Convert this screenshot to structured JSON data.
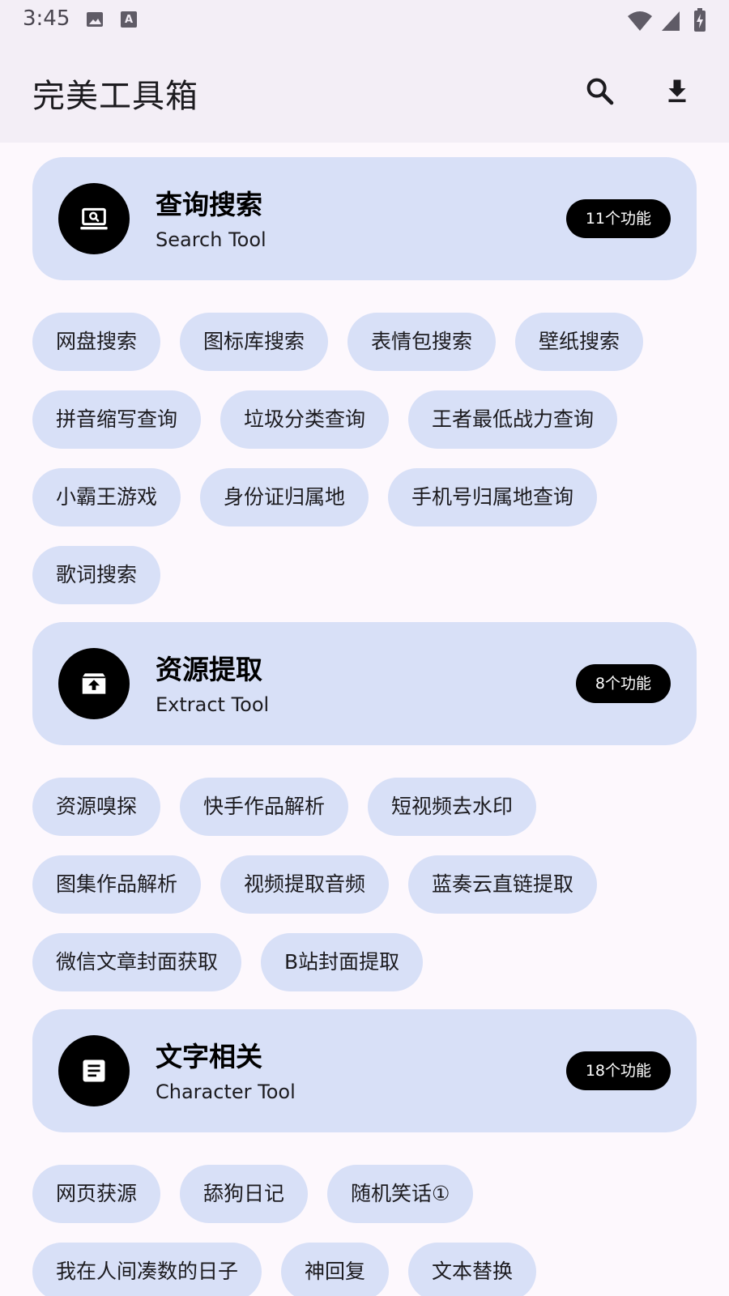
{
  "status_bar": {
    "time": "3:45"
  },
  "app_bar": {
    "title": "完美工具箱",
    "icons": [
      "search-icon",
      "download-icon"
    ]
  },
  "sections": [
    {
      "icon": "laptop-search-icon",
      "title": "查询搜索",
      "subtitle": "Search Tool",
      "badge": "11个功能",
      "chips": [
        "网盘搜索",
        "图标库搜索",
        "表情包搜索",
        "壁纸搜索",
        "拼音缩写查询",
        "垃圾分类查询",
        "王者最低战力查询",
        "小霸王游戏",
        "身份证归属地",
        "手机号归属地查询",
        "歌词搜索"
      ]
    },
    {
      "icon": "archive-upload-icon",
      "title": "资源提取",
      "subtitle": "Extract Tool",
      "badge": "8个功能",
      "chips": [
        "资源嗅探",
        "快手作品解析",
        "短视频去水印",
        "图集作品解析",
        "视频提取音频",
        "蓝奏云直链提取",
        "微信文章封面获取",
        "B站封面提取"
      ]
    },
    {
      "icon": "article-icon",
      "title": "文字相关",
      "subtitle": "Character Tool",
      "badge": "18个功能",
      "chips": [
        "网页获源",
        "舔狗日记",
        "随机笑话①",
        "我在人间凑数的日子",
        "神回复",
        "文本替换"
      ]
    }
  ],
  "colors": {
    "background": "#fdf8fd",
    "app_bar": "#f3eef6",
    "card": "#d8e0f7",
    "badge": "#000000"
  }
}
